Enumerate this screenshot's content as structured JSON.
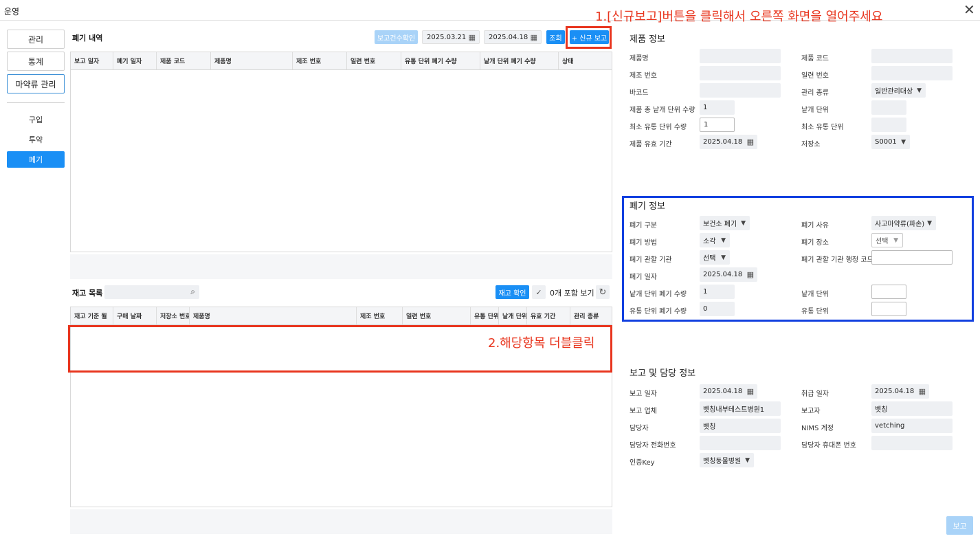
{
  "window": {
    "title": "운영"
  },
  "nav": {
    "items": [
      "관리",
      "통계",
      "마약류 관리"
    ],
    "sub": [
      "구입",
      "투약",
      "폐기"
    ]
  },
  "disposal_list": {
    "title": "폐기 내역",
    "check_btn": "보고건수확인",
    "date_from": "2025.03.21",
    "date_to": "2025.04.18",
    "search_btn": "조회",
    "new_btn": "+ 신규 보고",
    "columns": [
      "보고 일자",
      "폐기 일자",
      "제품 코드",
      "제품명",
      "제조 번호",
      "일련 번호",
      "유통 단위 폐기 수량",
      "낱개 단위 폐기 수량",
      "상태"
    ]
  },
  "stock_list": {
    "title": "재고 목록",
    "confirm_btn": "재고 확인",
    "include_label": "0개 포함 보기",
    "columns": [
      "재고 기준 월",
      "구매 날짜",
      "저장소 번호",
      "제품명",
      "제조 번호",
      "일련 번호",
      "유통 단위",
      "낱개 단위",
      "유효 기간",
      "관리 종류"
    ]
  },
  "annotations": {
    "step1": "1.[신규보고]버튼을 클릭해서 오른쪽 화면을 열어주세요",
    "step2": "2.해당항목 더블클릭"
  },
  "product_info": {
    "title": "제품 정보",
    "labels": {
      "name": "제품명",
      "code": "제품 코드",
      "mfg_no": "제조 번호",
      "serial_no": "일련 번호",
      "barcode": "바코드",
      "mgmt_type": "관리 종류",
      "total_units": "제품 총 낱개 단위 수량",
      "unit": "낱개 단위",
      "min_dist_qty": "최소 유통 단위 수량",
      "min_dist_unit": "최소 유통 단위",
      "expiry": "제품 유효 기간",
      "storage": "저장소"
    },
    "values": {
      "mgmt_type": "일반관리대상",
      "total_units": "1",
      "min_dist_qty": "1",
      "expiry": "2025.04.18",
      "storage": "S0001"
    }
  },
  "disposal_info": {
    "title": "폐기 정보",
    "labels": {
      "category": "폐기 구분",
      "reason": "폐기 사유",
      "method": "폐기 방법",
      "place": "폐기 장소",
      "authority": "폐기 관할 기관",
      "authority_code": "폐기 관할 기관 행정 코드",
      "date": "폐기 일자",
      "unit_qty": "낱개 단위 폐기 수량",
      "unit": "낱개 단위",
      "dist_qty": "유통 단위 폐기 수량",
      "dist_unit": "유통 단위"
    },
    "values": {
      "category": "보건소 폐기",
      "reason": "사고마약류(파손)",
      "method": "소각",
      "place": "선택",
      "authority": "선택",
      "date": "2025.04.18",
      "unit_qty": "1",
      "dist_qty": "0"
    }
  },
  "report_info": {
    "title": "보고 및 담당 정보",
    "labels": {
      "report_date": "보고 일자",
      "handle_date": "취급 일자",
      "company": "보고 업체",
      "reporter": "보고자",
      "manager": "담당자",
      "nims": "NIMS 계정",
      "phone": "담당자 전화번호",
      "mobile": "담당자 휴대폰 번호",
      "key": "인증Key"
    },
    "values": {
      "report_date": "2025.04.18",
      "handle_date": "2025.04.18",
      "company": "벳칭내부테스트병원1",
      "reporter": "벳칭",
      "manager": "벳칭",
      "nims": "vetching",
      "key": "벳칭동물병원"
    }
  },
  "footer": {
    "report_btn": "보고"
  }
}
